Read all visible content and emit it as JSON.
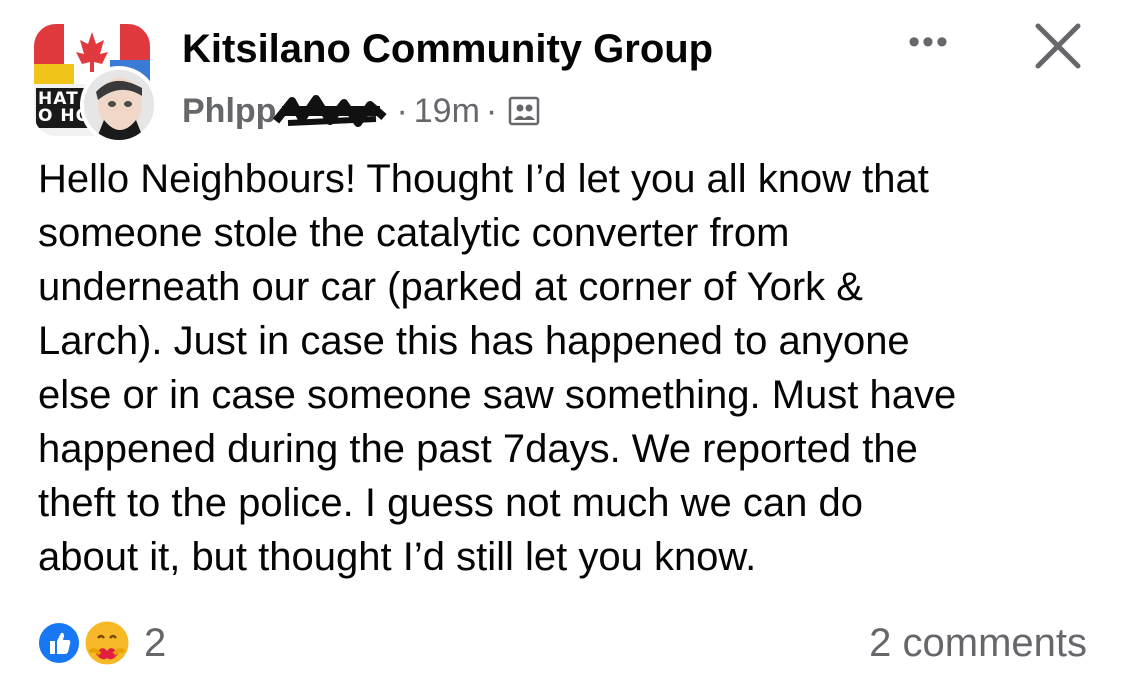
{
  "post": {
    "group_name": "Kitsilano Community Group",
    "author": "Phlpp",
    "time": "19m",
    "separator": "·",
    "group_avatar_text": "HAT\nO HO",
    "body_lines": [
      "Hello Neighbours! Thought I’d let you all know that",
      "someone stole the catalytic converter from",
      "underneath our car (parked at corner of York &",
      "Larch). Just in case this has happened to anyone",
      "else or in case someone saw something. Must have",
      "happened during the past 7days. We reported the",
      "theft to the police. I guess not much we can do",
      "about it, but thought I’d still let you know."
    ]
  },
  "actions": {
    "more_label": "•••",
    "close_icon": "close-icon"
  },
  "reactions": {
    "icons": [
      "like-icon",
      "care-icon"
    ],
    "count": "2",
    "comments_label": "2 comments"
  },
  "colors": {
    "text_primary": "#050505",
    "text_secondary": "#65676b",
    "like_blue": "#1877f2",
    "care_yellow": "#f7b928",
    "care_red": "#e41e3f"
  }
}
